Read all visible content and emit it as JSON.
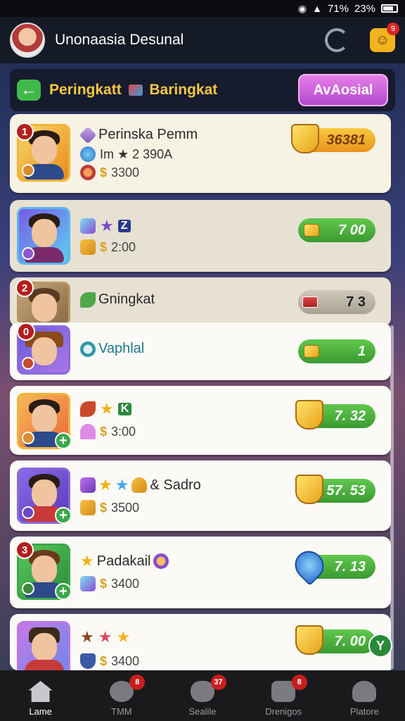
{
  "status_bar": {
    "signal_text": "71%",
    "battery_text": "23%"
  },
  "header": {
    "title": "Unonaasia Desunal",
    "mail_badge": "9"
  },
  "subheader": {
    "title_left": "Peringkatt",
    "title_right": "Baringkat",
    "action_label": "AvAosial"
  },
  "rows": [
    {
      "rank": "1",
      "name": "Perinska Pemm",
      "line2": "Im ★ 2 390A",
      "line3": "3300",
      "score": "36381"
    },
    {
      "line2_text": "Z",
      "line3": "2:00",
      "score": "7 00"
    },
    {
      "rank": "2",
      "name": "Gningkat",
      "score": "7 3"
    },
    {
      "rank": "0",
      "name": "Vaphlal",
      "score": "1"
    },
    {
      "line2_text": "K",
      "line3": "3:00",
      "score": "7. 32"
    },
    {
      "name": "& Sadro",
      "line3": "3500",
      "score": "57. 53"
    },
    {
      "rank": "3",
      "name": "Padakail",
      "line3": "3400",
      "score": "7. 13"
    },
    {
      "line3": "3400",
      "score": "7. 00"
    }
  ],
  "float_button": "Y",
  "nav": [
    {
      "label": "Lame",
      "badge": ""
    },
    {
      "label": "TMM",
      "badge": "8"
    },
    {
      "label": "Sealile",
      "badge": "37"
    },
    {
      "label": "Drenigos",
      "badge": "8"
    },
    {
      "label": "Platore",
      "badge": ""
    }
  ],
  "colors": {
    "accent_purple": "#c060e0",
    "accent_gold": "#f5c842",
    "score_green": "#3a9a30"
  }
}
